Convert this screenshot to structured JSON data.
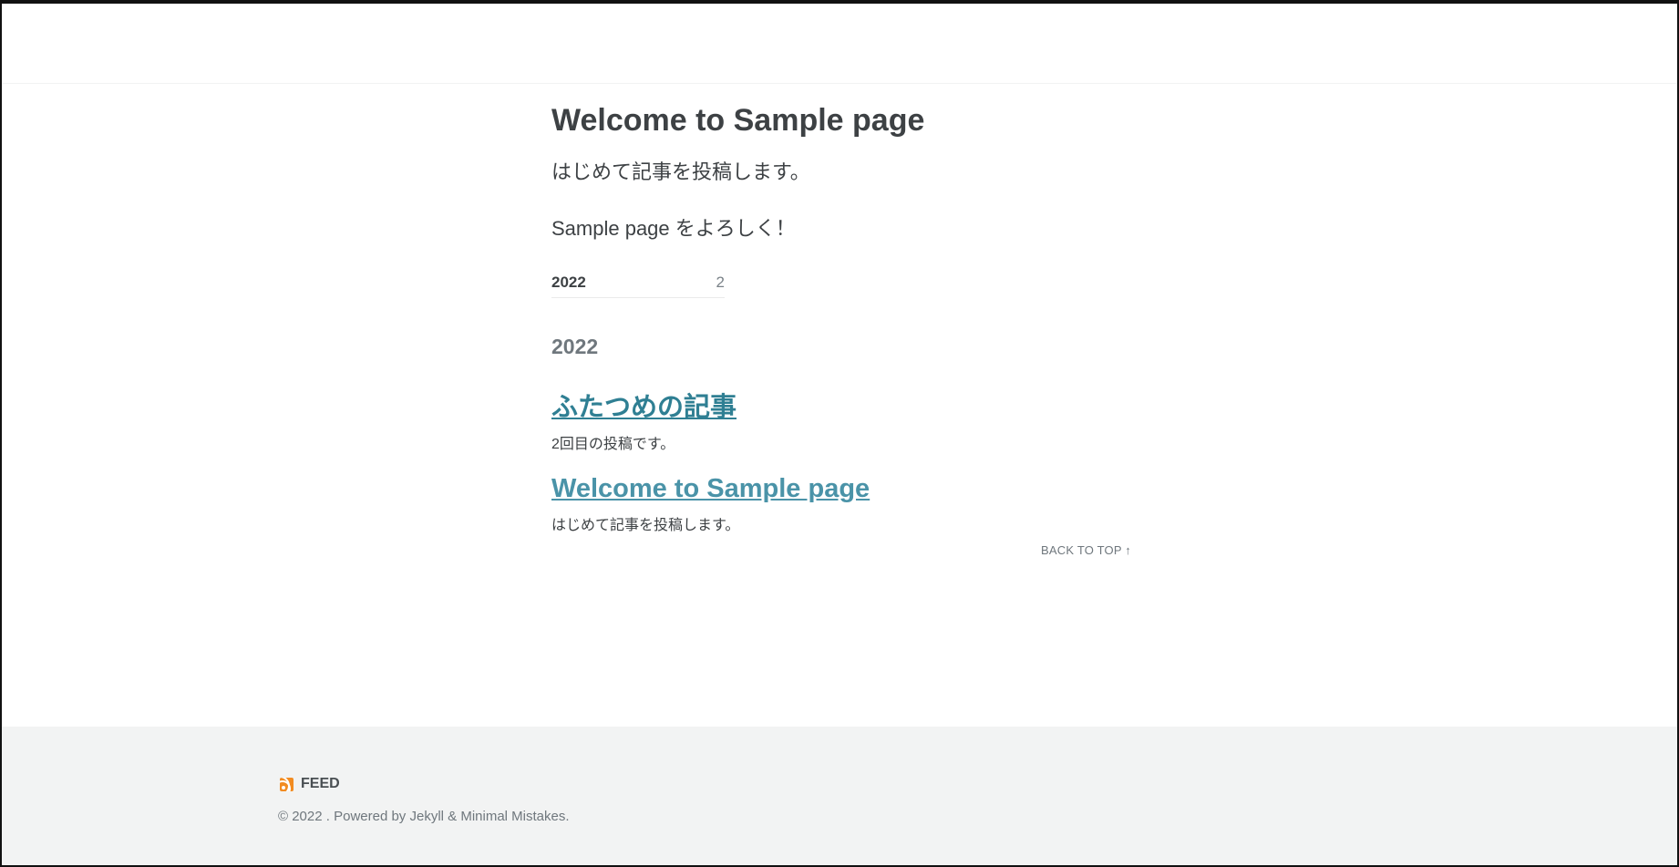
{
  "page": {
    "title": "Welcome to Sample page",
    "lead": "はじめて記事を投稿します。",
    "lead2": "Sample page をよろしく！"
  },
  "taxonomy": {
    "year": "2022",
    "count": "2"
  },
  "archive": {
    "year_heading": "2022",
    "posts": [
      {
        "title": "ふたつめの記事",
        "excerpt": "2回目の投稿です。"
      },
      {
        "title": "Welcome to Sample page",
        "excerpt": "はじめて記事を投稿します。"
      }
    ]
  },
  "back_to_top": "Back to top ↑",
  "footer": {
    "feed_label": "FEED",
    "feed_icon": "rss-icon",
    "copyright": "© 2022 . Powered by Jekyll & Minimal Mistakes."
  },
  "colors": {
    "link_primary": "#2f7f93",
    "link_secondary": "#4a93a8",
    "footer_bg": "#f2f3f3",
    "rss": "#f28c22"
  }
}
